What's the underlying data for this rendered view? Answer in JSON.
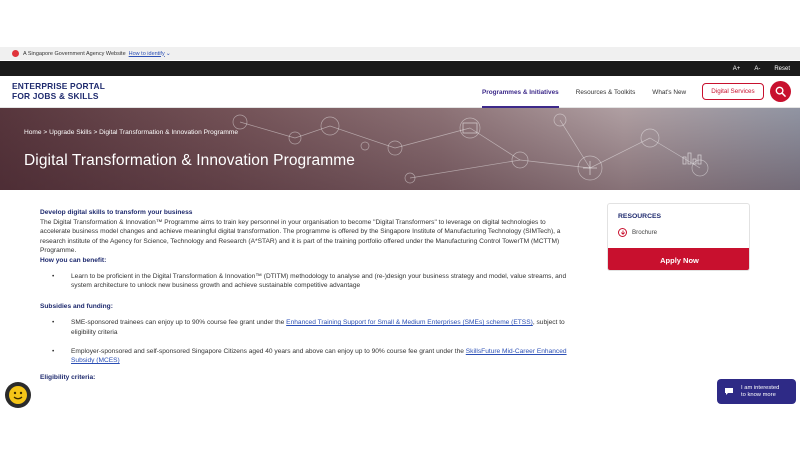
{
  "gov_bar": {
    "text": "A Singapore Government Agency Website",
    "link": "How to identify"
  },
  "accessibility": {
    "increase": "A+",
    "decrease": "A-",
    "reset": "Reset"
  },
  "header": {
    "logo_line1": "ENTERPRISE PORTAL",
    "logo_line2": "FOR JOBS & SKILLS",
    "nav": [
      {
        "label": "Programmes & Initiatives",
        "active": true
      },
      {
        "label": "Resources & Toolkits",
        "active": false
      },
      {
        "label": "What's New",
        "active": false
      }
    ],
    "digital_services": "Digital Services"
  },
  "hero": {
    "breadcrumb": "Home > Upgrade Skills > Digital Transformation & Innovation Programme",
    "title": "Digital Transformation & Innovation Programme"
  },
  "content": {
    "intro_heading": "Develop digital skills to transform your business",
    "intro_text": "The Digital Transformation & Innovation™ Programme aims to train key personnel in your organisation to become \"Digital Transformers\" to leverage on digital technologies to accelerate business model changes and achieve meaningful digital transformation. The programme is offered by the Singapore Institute of Manufacturing Technology (SIMTech), a research institute of the Agency for Science, Technology and Research (A*STAR) and it is part of the training portfolio offered under the Manufacturing Control TowerTM (MCTTM) Programme.",
    "benefit_heading": "How you can benefit:",
    "benefit_item": "Learn to be proficient in the Digital Transformation & Innovation™ (DTITM) methodology to analyse and (re-)design your business strategy and model, value streams, and system architecture to unlock new business growth and achieve sustainable competitive advantage",
    "subsidy_heading": "Subsidies and funding:",
    "subsidy1_pre": "SME-sponsored trainees can enjoy up to 90% course fee grant under the ",
    "subsidy1_link": "Enhanced Training Support for Small & Medium Enterprises (SMEs) scheme (ETSS)",
    "subsidy1_post": ", subject to eligibility criteria",
    "subsidy2_pre": "Employer-sponsored and self-sponsored Singapore Citizens aged 40 years and above can enjoy up to 90% course fee grant under the ",
    "subsidy2_link": "SkillsFuture Mid-Career Enhanced Subsidy (MCES)",
    "eligibility_heading": "Eligibility criteria:"
  },
  "sidebar": {
    "resources_title": "RESOURCES",
    "brochure": "Brochure",
    "apply": "Apply Now"
  },
  "chat": {
    "line1": "I am interested",
    "line2": "to know more"
  },
  "colors": {
    "brand_red": "#c8102e",
    "navy": "#1e2a6e",
    "chat_purple": "#2e2a86"
  }
}
